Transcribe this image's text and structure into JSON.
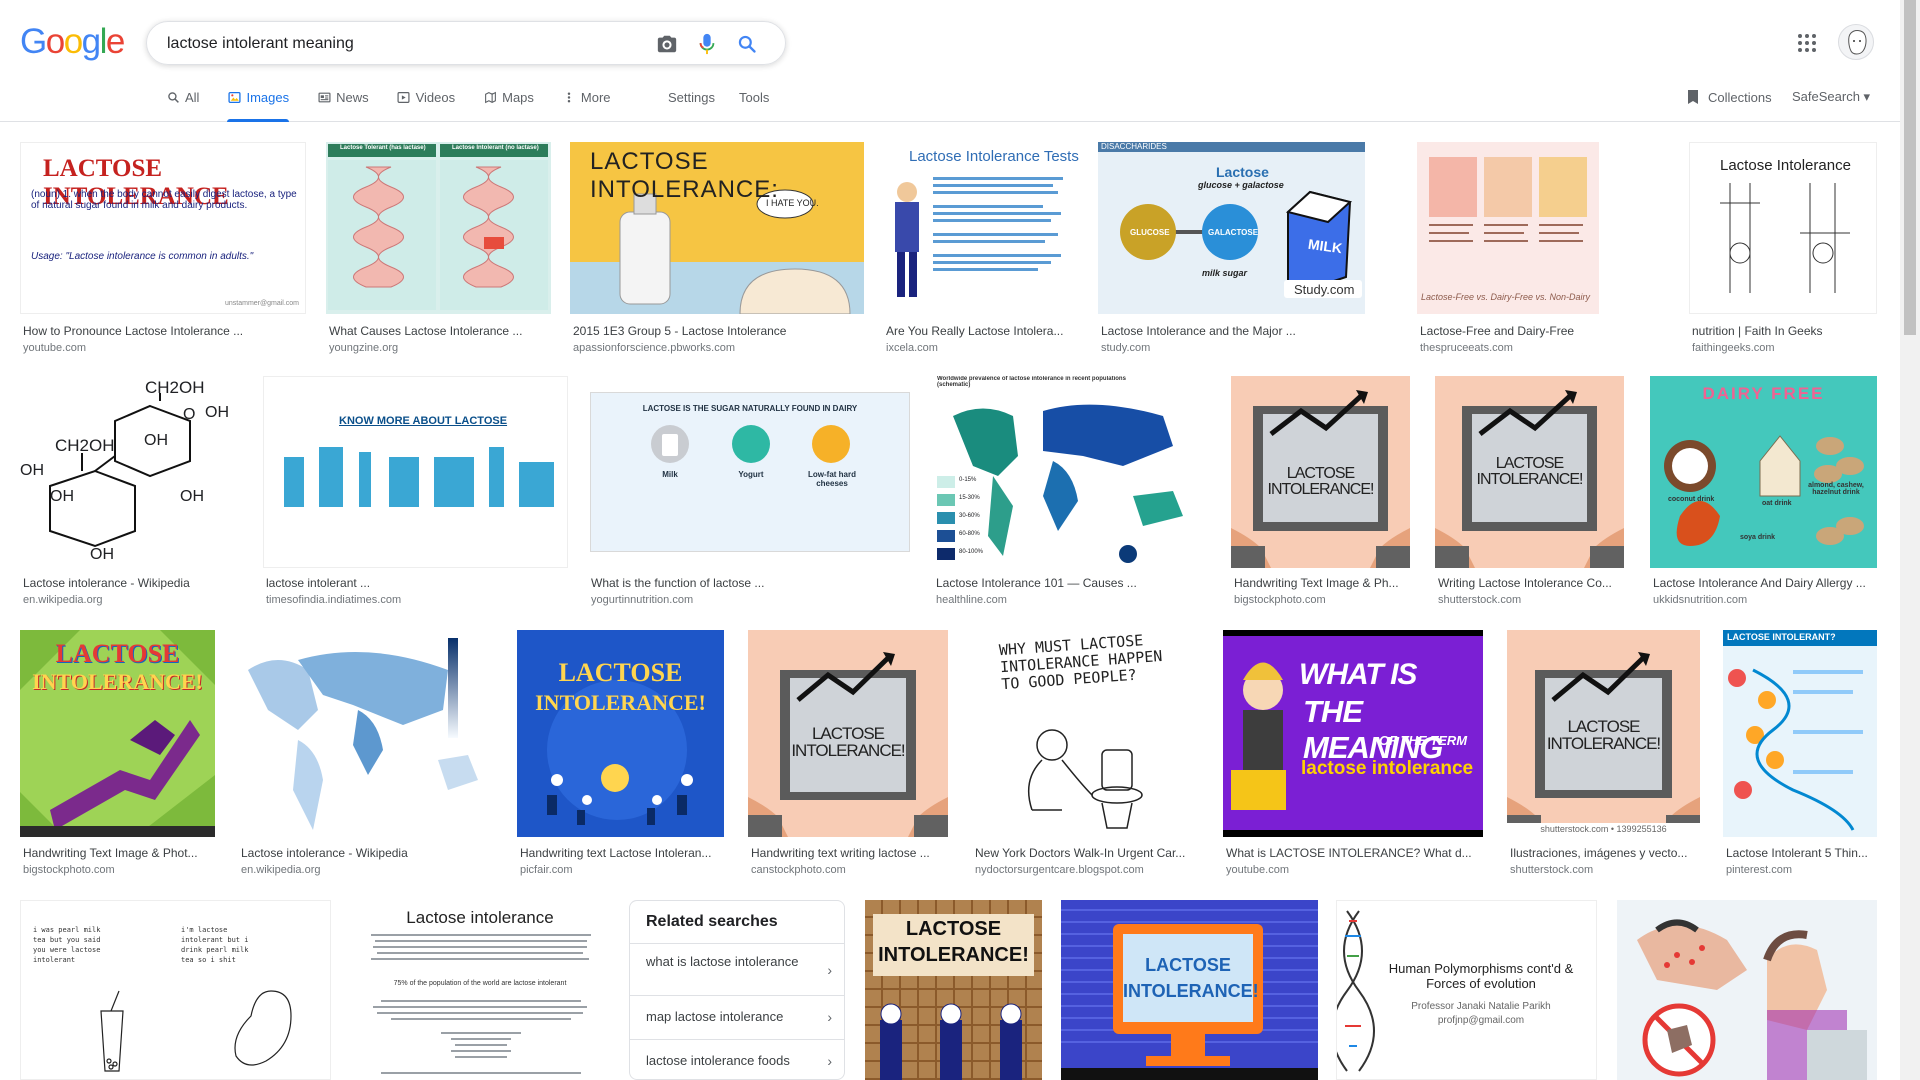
{
  "brand": {
    "logo_letters": [
      "G",
      "o",
      "o",
      "g",
      "l",
      "e"
    ],
    "logo_colors": [
      "#4285F4",
      "#EA4335",
      "#FBBC05",
      "#4285F4",
      "#34A853",
      "#EA4335"
    ]
  },
  "search": {
    "query": "lactose intolerant meaning"
  },
  "tabs": [
    {
      "label": "All",
      "icon": "search-icon"
    },
    {
      "label": "Images",
      "icon": "image-icon",
      "active": true
    },
    {
      "label": "News",
      "icon": "news-icon"
    },
    {
      "label": "Videos",
      "icon": "video-icon"
    },
    {
      "label": "Maps",
      "icon": "map-icon"
    },
    {
      "label": "More",
      "icon": "more-vert-icon"
    }
  ],
  "tools": {
    "settings": "Settings",
    "tools": "Tools"
  },
  "right": {
    "collections": "Collections",
    "safesearch": "SafeSearch ▾"
  },
  "colors": {
    "accent": "#1a73e8",
    "title_red": "#c5221f"
  },
  "results": [
    {
      "title": "How to Pronounce Lactose Intolerance ...",
      "source": "youtube.com",
      "thumb_text": "LACTOSE INTOLERANCE",
      "thumb_small": "(noun) 1. when the body cannot easily digest lactose, a type of natural sugar found in milk and dairy products.",
      "thumb_small2": "Usage: \"Lactose intolerance is common in adults.\"",
      "thumb_tag": "unstammer@gmail.com"
    },
    {
      "title": "What Causes Lactose Intolerance ...",
      "source": "youngzine.org",
      "thumb_text": "Lactose Tolerant (has lactase)",
      "thumb_text2": "Lactose Intolerant (no lactase)"
    },
    {
      "title": "2015 1E3 Group 5 - Lactose Intolerance",
      "source": "apassionforscience.pbworks.com",
      "thumb_text": "LACTOSE INTOLERANCE:",
      "thumb_text2": "I HATE YOU."
    },
    {
      "title": "Are You Really Lactose Intolera...",
      "source": "ixcela.com",
      "thumb_text": "Lactose Intolerance Tests"
    },
    {
      "title": "Lactose Intolerance and the Major ...",
      "source": "study.com",
      "thumb_text": "Lactose",
      "thumb_text2": "glucose + galactose",
      "thumb_tag": "DISACCHARIDES",
      "thumb_labels": [
        "GLUCOSE",
        "GALACTOSE",
        "MILK",
        "milk sugar",
        "Study.com"
      ]
    },
    {
      "title": "Lactose-Free and Dairy-Free",
      "source": "thespruceeats.com",
      "thumb_text": "Lactose-Free vs. Dairy-Free vs. Non-Dairy"
    },
    {
      "title": "nutrition | Faith In Geeks",
      "source": "faithingeeks.com",
      "thumb_text": "Lactose Intolerance"
    },
    {
      "title": "Lactose intolerance - Wikipedia",
      "source": "en.wikipedia.org",
      "thumb_labels": [
        "CH2OH",
        "O",
        "OH",
        "CH2OH",
        "OH",
        "OH",
        "OH",
        "OH",
        "OH"
      ]
    },
    {
      "title": "lactose intolerant ...",
      "source": "timesofindia.indiatimes.com",
      "thumb_text": "KNOW MORE ABOUT LACTOSE"
    },
    {
      "title": "What is the function of lactose ...",
      "source": "yogurtinnutrition.com",
      "thumb_text": "LACTOSE IS THE SUGAR NATURALLY FOUND IN DAIRY",
      "thumb_labels": [
        "Milk",
        "Yogurt",
        "Low-fat hard cheeses"
      ]
    },
    {
      "title": "Lactose Intolerance 101 — Causes ...",
      "source": "healthline.com",
      "thumb_text": "Worldwide prevalence of lactose intolerance in recent populations (schematic)",
      "thumb_labels": [
        "0-15%",
        "15-30%",
        "30-60%",
        "60-80%",
        "80-100%"
      ]
    },
    {
      "title": "Handwriting Text Image & Ph...",
      "source": "bigstockphoto.com",
      "thumb_text": "LACTOSE INTOLERANCE!"
    },
    {
      "title": "Writing Lactose Intolerance Co...",
      "source": "shutterstock.com",
      "thumb_text": "LACTOSE INTOLERANCE!"
    },
    {
      "title": "Lactose Intolerance And Dairy Allergy ...",
      "source": "ukkidsnutrition.com",
      "thumb_text": "DAIRY FREE",
      "thumb_labels": [
        "coconut drink",
        "oat drink",
        "almond, cashew, hazelnut drink",
        "soya drink"
      ]
    },
    {
      "title": "Handwriting Text Image & Phot...",
      "source": "bigstockphoto.com",
      "thumb_text": "LACTOSE",
      "thumb_text2": "INTOLERANCE!"
    },
    {
      "title": "Lactose intolerance - Wikipedia",
      "source": "en.wikipedia.org"
    },
    {
      "title": "Handwriting text Lactose Intoleran...",
      "source": "picfair.com",
      "thumb_text": "LACTOSE",
      "thumb_text2": "INTOLERANCE!"
    },
    {
      "title": "Handwriting text writing lactose ...",
      "source": "canstockphoto.com",
      "thumb_text": "LACTOSE INTOLERANCE!"
    },
    {
      "title": "New York Doctors Walk-In Urgent Car...",
      "source": "nydoctorsurgentcare.blogspot.com",
      "thumb_text": "WHY MUST LACTOSE INTOLERANCE HAPPEN TO GOOD PEOPLE?"
    },
    {
      "title": "What is LACTOSE INTOLERANCE? What d...",
      "source": "youtube.com",
      "thumb_text": "WHAT IS",
      "thumb_text2": "THE MEANING",
      "thumb_text3": "OF THE TERM",
      "thumb_text4": "lactose intolerance"
    },
    {
      "title": "Ilustraciones, imágenes y vecto...",
      "source": "shutterstock.com",
      "thumb_text": "LACTOSE INTOLERANCE!",
      "thumb_tag": "shutterstock.com • 1399255136"
    },
    {
      "title": "Lactose Intolerant 5 Thin...",
      "source": "pinterest.com",
      "thumb_text": "LACTOSE INTOLERANT?"
    },
    {
      "thumb_text": "i was pearl milk tea but you said you were lactose intolerant",
      "thumb_text2": "i'm lactose intolerant but i drink pearl milk tea so i shit"
    },
    {
      "thumb_text": "Lactose intolerance",
      "thumb_text2": "75% of the population of the world are lactose intolerant"
    },
    {
      "thumb_text": "LACTOSE INTOLERANCE!"
    },
    {
      "thumb_text": "LACTOSE INTOLERANCE!"
    },
    {
      "thumb_text": "Human Polymorphisms cont'd & Forces of evolution",
      "thumb_text2": "Professor Janaki Natalie Parikh",
      "thumb_text3": "profjnp@gmail.com"
    },
    {}
  ],
  "related": {
    "heading": "Related searches",
    "items": [
      "what is lactose intolerance",
      "map lactose intolerance",
      "lactose intolerance foods"
    ]
  }
}
